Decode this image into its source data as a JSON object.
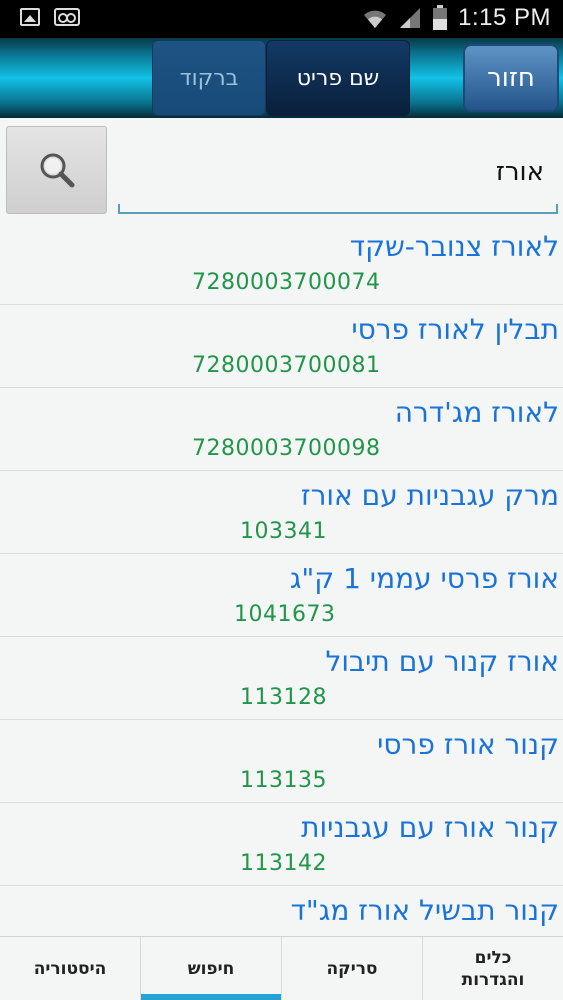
{
  "status_bar": {
    "time": "1:15 PM",
    "left_icons": [
      "image-icon",
      "voicemail-icon"
    ],
    "right_icons": [
      "wifi-icon",
      "signal-icon",
      "battery-icon"
    ]
  },
  "top_bar": {
    "back_label": "חזור",
    "segments": [
      {
        "label": "שם פריט",
        "active": true
      },
      {
        "label": "ברקוד",
        "active": false
      }
    ],
    "colors": {
      "active_segment": "#0a1f3a",
      "back_button": "#23558a",
      "bar_glow": "#12c2e6"
    }
  },
  "search": {
    "value": "אורז",
    "button_icon": "search-icon"
  },
  "results": [
    {
      "name": "לאורז צנובר-שקד",
      "code": "7280003700074"
    },
    {
      "name": "תבלין לאורז פרסי",
      "code": "7280003700081"
    },
    {
      "name": "לאורז מג'דרה",
      "code": "7280003700098"
    },
    {
      "name": "מרק עגבניות עם אורז",
      "code": "103341"
    },
    {
      "name": "אורז פרסי עממי 1 ק\"ג",
      "code": "1041673"
    },
    {
      "name": "אורז קנור עם תיבול",
      "code": "113128"
    },
    {
      "name": "קנור אורז פרסי",
      "code": "113135"
    },
    {
      "name": "קנור אורז עם עגבניות",
      "code": "113142"
    },
    {
      "name": "קנור תבשיל אורז מג\"ד",
      "code": ""
    }
  ],
  "colors": {
    "item_name": "#1a73d9",
    "item_code": "#22954a",
    "nav_active": "#23a3d6"
  },
  "bottom_nav": [
    {
      "label": "היסטוריה",
      "active": false
    },
    {
      "label": "חיפוש",
      "active": true
    },
    {
      "label": "סריקה",
      "active": false
    },
    {
      "label": "כלים\nוהגדרות",
      "active": false
    }
  ]
}
